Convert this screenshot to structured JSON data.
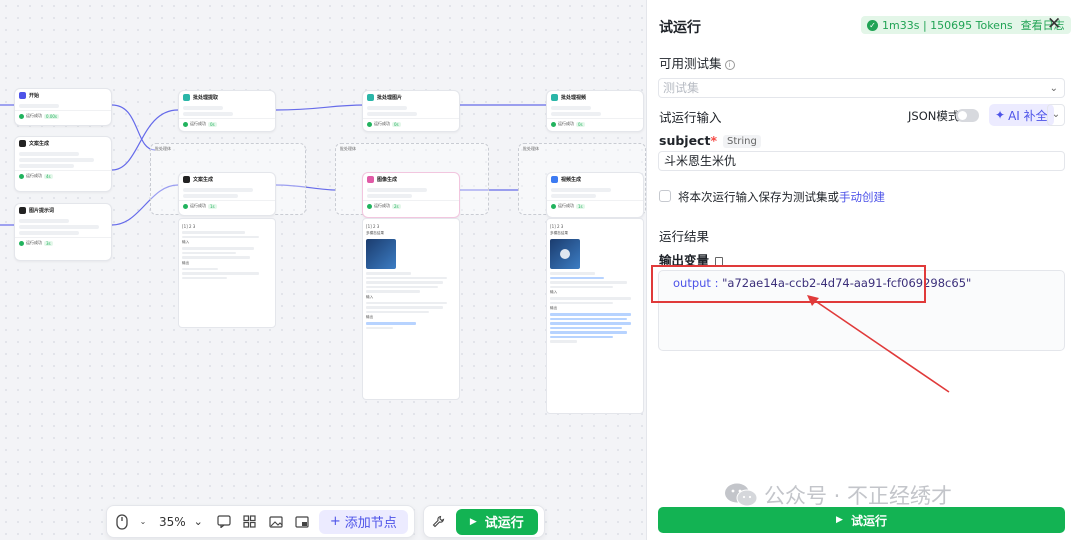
{
  "canvas": {
    "nodes": [
      {
        "id": "start",
        "title": "开始",
        "color": "#4d53e8",
        "status": "运行成功",
        "time": "0.00s"
      },
      {
        "id": "text1",
        "title": "文案生成",
        "color": "#222222",
        "status": "运行成功",
        "time": "4s"
      },
      {
        "id": "imgprompt",
        "title": "图片提示词",
        "color": "#222222",
        "status": "运行成功",
        "time": "3s"
      },
      {
        "id": "batch1",
        "title": "批处理提取",
        "color": "#2bb6a8",
        "status": "运行成功",
        "time": "0s"
      },
      {
        "id": "batch2",
        "title": "批处理图片",
        "color": "#2bb6a8",
        "status": "运行成功",
        "time": "0s"
      },
      {
        "id": "batch3",
        "title": "批处理视频",
        "color": "#2bb6a8",
        "status": "运行成功",
        "time": "0s"
      },
      {
        "id": "textgen",
        "title": "文案生成",
        "color": "#222222",
        "status": "运行成功",
        "time": "1s"
      },
      {
        "id": "imagegen",
        "title": "图像生成",
        "color": "#e05aa6",
        "status": "运行成功",
        "time": "2s"
      },
      {
        "id": "videogen",
        "title": "视频生成",
        "color": "#3d7bf2",
        "status": "运行成功",
        "time": "1s"
      }
    ],
    "groups": [
      {
        "id": "g1",
        "label": "批处理体"
      },
      {
        "id": "g2",
        "label": "批处理体"
      },
      {
        "id": "g3",
        "label": "批处理体"
      }
    ],
    "panel_labels": {
      "page": "1",
      "pages": [
        "1",
        "2",
        "3"
      ],
      "output": "输出",
      "input": "输入",
      "image_title": "多模态结果"
    }
  },
  "toolbar": {
    "zoom": "35%",
    "add_node": "添加节点",
    "run": "试运行"
  },
  "side": {
    "title": "试运行",
    "stats": "1m33s | 150695 Tokens",
    "view_log": "查看日志",
    "testset_label": "可用测试集",
    "testset_placeholder": "测试集",
    "input_label": "试运行输入",
    "json_mode": "JSON模式",
    "ai_fill": "AI 补全",
    "field_name": "subject",
    "field_type": "String",
    "field_value": "斗米恩生米仇",
    "save_text": "将本次运行输入保存为测试集或",
    "save_link": "手动创建",
    "result_label": "运行结果",
    "output_var_label": "输出变量",
    "output_key": "output",
    "output_value": "\"a72ae14a-ccb2-4d74-aa91-fcf069298c65\"",
    "run_button": "试运行",
    "watermark": "公众号 · 不正经绣才"
  },
  "colors": {
    "brand": "#4d53e8",
    "success": "#13b353",
    "highlight": "#e03a3a"
  }
}
